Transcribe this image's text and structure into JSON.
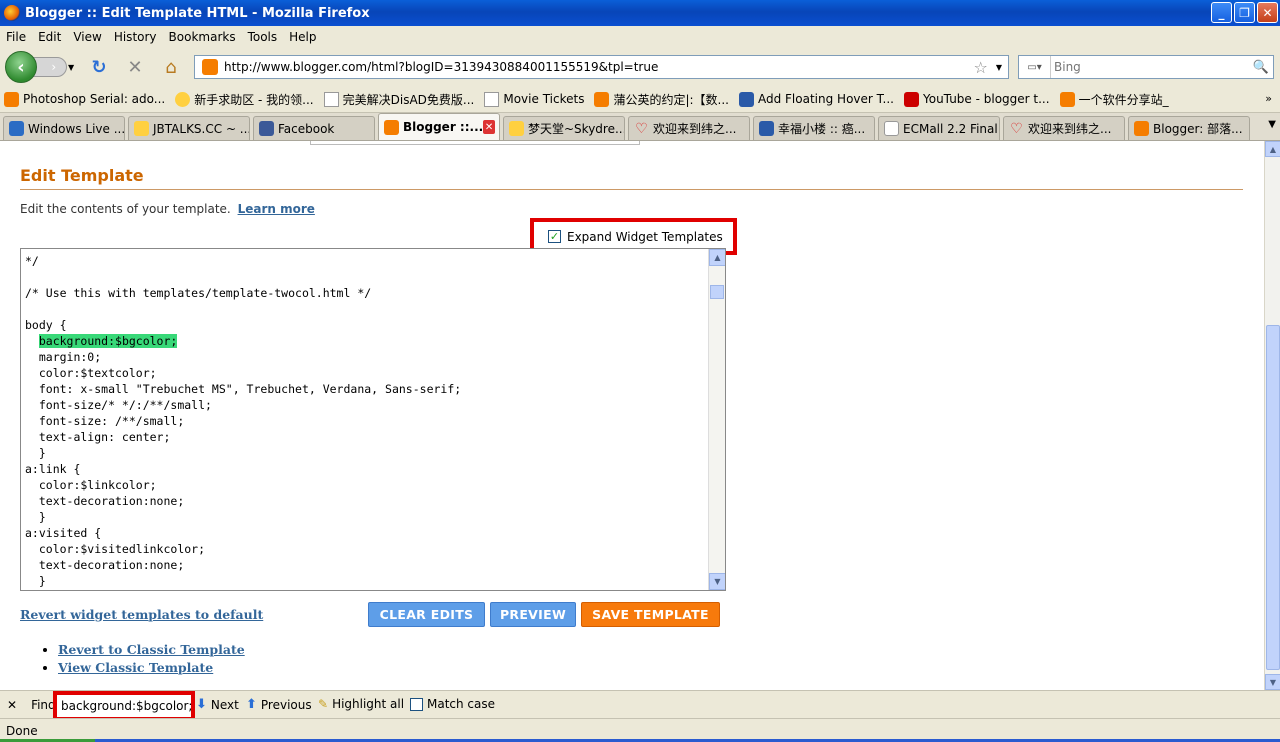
{
  "window": {
    "title": "Blogger :: Edit Template HTML - Mozilla Firefox"
  },
  "menu": [
    "File",
    "Edit",
    "View",
    "History",
    "Bookmarks",
    "Tools",
    "Help"
  ],
  "nav": {
    "url": "http://www.blogger.com/html?blogID=3139430884001155519&tpl=true",
    "search_placeholder": "Bing"
  },
  "bookmarks": [
    {
      "label": "Photoshop Serial: ado...",
      "icon": "blogger-icon"
    },
    {
      "label": "新手求助区 - 我的领...",
      "icon": "smiley-icon"
    },
    {
      "label": "完美解决DisAD免费版...",
      "icon": "page-icon"
    },
    {
      "label": "Movie Tickets",
      "icon": "page-icon"
    },
    {
      "label": "蒲公英的约定|:【数...",
      "icon": "blogger-icon"
    },
    {
      "label": "Add Floating Hover T...",
      "icon": "dollar-icon"
    },
    {
      "label": "YouTube - blogger t...",
      "icon": "youtube-icon"
    },
    {
      "label": "一个软件分享站_",
      "icon": "blogger-icon"
    }
  ],
  "tabs": [
    {
      "label": "Windows Live ...",
      "icon": "windows-live-icon",
      "active": false
    },
    {
      "label": "JBTALKS.CC ~ ...",
      "icon": "smiley-icon",
      "active": false
    },
    {
      "label": "Facebook",
      "icon": "facebook-icon",
      "active": false
    },
    {
      "label": "Blogger ::...",
      "icon": "blogger-icon",
      "active": true
    },
    {
      "label": "梦天堂~Skydre...",
      "icon": "smiley-icon",
      "active": false
    },
    {
      "label": "欢迎来到纬之...",
      "icon": "heart-icon",
      "active": false
    },
    {
      "label": "幸福小楼 :: 癌...",
      "icon": "speech-icon",
      "active": false
    },
    {
      "label": "ECMall 2.2 Final...",
      "icon": "page-icon",
      "active": false
    },
    {
      "label": "欢迎来到纬之...",
      "icon": "heart-icon",
      "active": false
    },
    {
      "label": "Blogger: 部落...",
      "icon": "blogger-icon",
      "active": false
    }
  ],
  "page": {
    "heading": "Edit Template",
    "description": "Edit the contents of your template.",
    "learn_more": "Learn more",
    "expand_label": "Expand Widget Templates",
    "expand_checked": true,
    "code_lines": [
      "*/",
      "",
      "/* Use this with templates/template-twocol.html */",
      "",
      "body {",
      "  background:$bgcolor;",
      "  margin:0;",
      "  color:$textcolor;",
      "  font: x-small \"Trebuchet MS\", Trebuchet, Verdana, Sans-serif;",
      "  font-size/* */:/**/small;",
      "  font-size: /**/small;",
      "  text-align: center;",
      "  }",
      "a:link {",
      "  color:$linkcolor;",
      "  text-decoration:none;",
      "  }",
      "a:visited {",
      "  color:$visitedlinkcolor;",
      "  text-decoration:none;",
      "  }"
    ],
    "revert_default": "Revert widget templates to default",
    "btn_clear": "CLEAR EDITS",
    "btn_preview": "PREVIEW",
    "btn_save": "SAVE TEMPLATE",
    "link_revert_classic": "Revert to Classic Template",
    "link_view_classic": "View Classic Template"
  },
  "find": {
    "label": "Find:",
    "value": "background:$bgcolor;",
    "next": "Next",
    "previous": "Previous",
    "highlight": "Highlight all",
    "match_case": "Match case"
  },
  "status": {
    "text": "Done"
  }
}
